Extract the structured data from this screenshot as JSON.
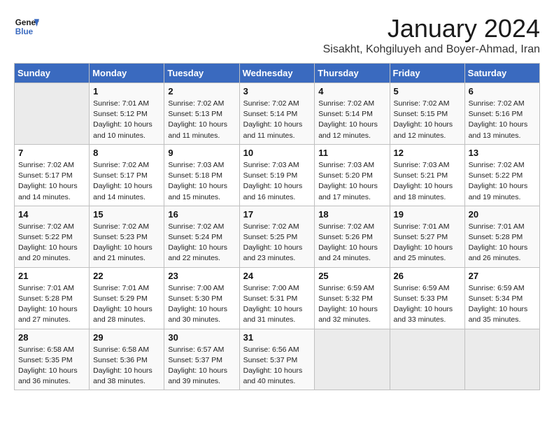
{
  "logo": {
    "line1": "General",
    "line2": "Blue"
  },
  "title": "January 2024",
  "subtitle": "Sisakht, Kohgiluyeh and Boyer-Ahmad, Iran",
  "weekdays": [
    "Sunday",
    "Monday",
    "Tuesday",
    "Wednesday",
    "Thursday",
    "Friday",
    "Saturday"
  ],
  "weeks": [
    [
      {
        "day": "",
        "sunrise": "",
        "sunset": "",
        "daylight": "",
        "empty": true
      },
      {
        "day": "1",
        "sunrise": "Sunrise: 7:01 AM",
        "sunset": "Sunset: 5:12 PM",
        "daylight": "Daylight: 10 hours and 10 minutes."
      },
      {
        "day": "2",
        "sunrise": "Sunrise: 7:02 AM",
        "sunset": "Sunset: 5:13 PM",
        "daylight": "Daylight: 10 hours and 11 minutes."
      },
      {
        "day": "3",
        "sunrise": "Sunrise: 7:02 AM",
        "sunset": "Sunset: 5:14 PM",
        "daylight": "Daylight: 10 hours and 11 minutes."
      },
      {
        "day": "4",
        "sunrise": "Sunrise: 7:02 AM",
        "sunset": "Sunset: 5:14 PM",
        "daylight": "Daylight: 10 hours and 12 minutes."
      },
      {
        "day": "5",
        "sunrise": "Sunrise: 7:02 AM",
        "sunset": "Sunset: 5:15 PM",
        "daylight": "Daylight: 10 hours and 12 minutes."
      },
      {
        "day": "6",
        "sunrise": "Sunrise: 7:02 AM",
        "sunset": "Sunset: 5:16 PM",
        "daylight": "Daylight: 10 hours and 13 minutes."
      }
    ],
    [
      {
        "day": "7",
        "sunrise": "Sunrise: 7:02 AM",
        "sunset": "Sunset: 5:17 PM",
        "daylight": "Daylight: 10 hours and 14 minutes."
      },
      {
        "day": "8",
        "sunrise": "Sunrise: 7:02 AM",
        "sunset": "Sunset: 5:17 PM",
        "daylight": "Daylight: 10 hours and 14 minutes."
      },
      {
        "day": "9",
        "sunrise": "Sunrise: 7:03 AM",
        "sunset": "Sunset: 5:18 PM",
        "daylight": "Daylight: 10 hours and 15 minutes."
      },
      {
        "day": "10",
        "sunrise": "Sunrise: 7:03 AM",
        "sunset": "Sunset: 5:19 PM",
        "daylight": "Daylight: 10 hours and 16 minutes."
      },
      {
        "day": "11",
        "sunrise": "Sunrise: 7:03 AM",
        "sunset": "Sunset: 5:20 PM",
        "daylight": "Daylight: 10 hours and 17 minutes."
      },
      {
        "day": "12",
        "sunrise": "Sunrise: 7:03 AM",
        "sunset": "Sunset: 5:21 PM",
        "daylight": "Daylight: 10 hours and 18 minutes."
      },
      {
        "day": "13",
        "sunrise": "Sunrise: 7:02 AM",
        "sunset": "Sunset: 5:22 PM",
        "daylight": "Daylight: 10 hours and 19 minutes."
      }
    ],
    [
      {
        "day": "14",
        "sunrise": "Sunrise: 7:02 AM",
        "sunset": "Sunset: 5:22 PM",
        "daylight": "Daylight: 10 hours and 20 minutes."
      },
      {
        "day": "15",
        "sunrise": "Sunrise: 7:02 AM",
        "sunset": "Sunset: 5:23 PM",
        "daylight": "Daylight: 10 hours and 21 minutes."
      },
      {
        "day": "16",
        "sunrise": "Sunrise: 7:02 AM",
        "sunset": "Sunset: 5:24 PM",
        "daylight": "Daylight: 10 hours and 22 minutes."
      },
      {
        "day": "17",
        "sunrise": "Sunrise: 7:02 AM",
        "sunset": "Sunset: 5:25 PM",
        "daylight": "Daylight: 10 hours and 23 minutes."
      },
      {
        "day": "18",
        "sunrise": "Sunrise: 7:02 AM",
        "sunset": "Sunset: 5:26 PM",
        "daylight": "Daylight: 10 hours and 24 minutes."
      },
      {
        "day": "19",
        "sunrise": "Sunrise: 7:01 AM",
        "sunset": "Sunset: 5:27 PM",
        "daylight": "Daylight: 10 hours and 25 minutes."
      },
      {
        "day": "20",
        "sunrise": "Sunrise: 7:01 AM",
        "sunset": "Sunset: 5:28 PM",
        "daylight": "Daylight: 10 hours and 26 minutes."
      }
    ],
    [
      {
        "day": "21",
        "sunrise": "Sunrise: 7:01 AM",
        "sunset": "Sunset: 5:28 PM",
        "daylight": "Daylight: 10 hours and 27 minutes."
      },
      {
        "day": "22",
        "sunrise": "Sunrise: 7:01 AM",
        "sunset": "Sunset: 5:29 PM",
        "daylight": "Daylight: 10 hours and 28 minutes."
      },
      {
        "day": "23",
        "sunrise": "Sunrise: 7:00 AM",
        "sunset": "Sunset: 5:30 PM",
        "daylight": "Daylight: 10 hours and 30 minutes."
      },
      {
        "day": "24",
        "sunrise": "Sunrise: 7:00 AM",
        "sunset": "Sunset: 5:31 PM",
        "daylight": "Daylight: 10 hours and 31 minutes."
      },
      {
        "day": "25",
        "sunrise": "Sunrise: 6:59 AM",
        "sunset": "Sunset: 5:32 PM",
        "daylight": "Daylight: 10 hours and 32 minutes."
      },
      {
        "day": "26",
        "sunrise": "Sunrise: 6:59 AM",
        "sunset": "Sunset: 5:33 PM",
        "daylight": "Daylight: 10 hours and 33 minutes."
      },
      {
        "day": "27",
        "sunrise": "Sunrise: 6:59 AM",
        "sunset": "Sunset: 5:34 PM",
        "daylight": "Daylight: 10 hours and 35 minutes."
      }
    ],
    [
      {
        "day": "28",
        "sunrise": "Sunrise: 6:58 AM",
        "sunset": "Sunset: 5:35 PM",
        "daylight": "Daylight: 10 hours and 36 minutes."
      },
      {
        "day": "29",
        "sunrise": "Sunrise: 6:58 AM",
        "sunset": "Sunset: 5:36 PM",
        "daylight": "Daylight: 10 hours and 38 minutes."
      },
      {
        "day": "30",
        "sunrise": "Sunrise: 6:57 AM",
        "sunset": "Sunset: 5:37 PM",
        "daylight": "Daylight: 10 hours and 39 minutes."
      },
      {
        "day": "31",
        "sunrise": "Sunrise: 6:56 AM",
        "sunset": "Sunset: 5:37 PM",
        "daylight": "Daylight: 10 hours and 40 minutes."
      },
      {
        "day": "",
        "sunrise": "",
        "sunset": "",
        "daylight": "",
        "empty": true
      },
      {
        "day": "",
        "sunrise": "",
        "sunset": "",
        "daylight": "",
        "empty": true
      },
      {
        "day": "",
        "sunrise": "",
        "sunset": "",
        "daylight": "",
        "empty": true
      }
    ]
  ]
}
